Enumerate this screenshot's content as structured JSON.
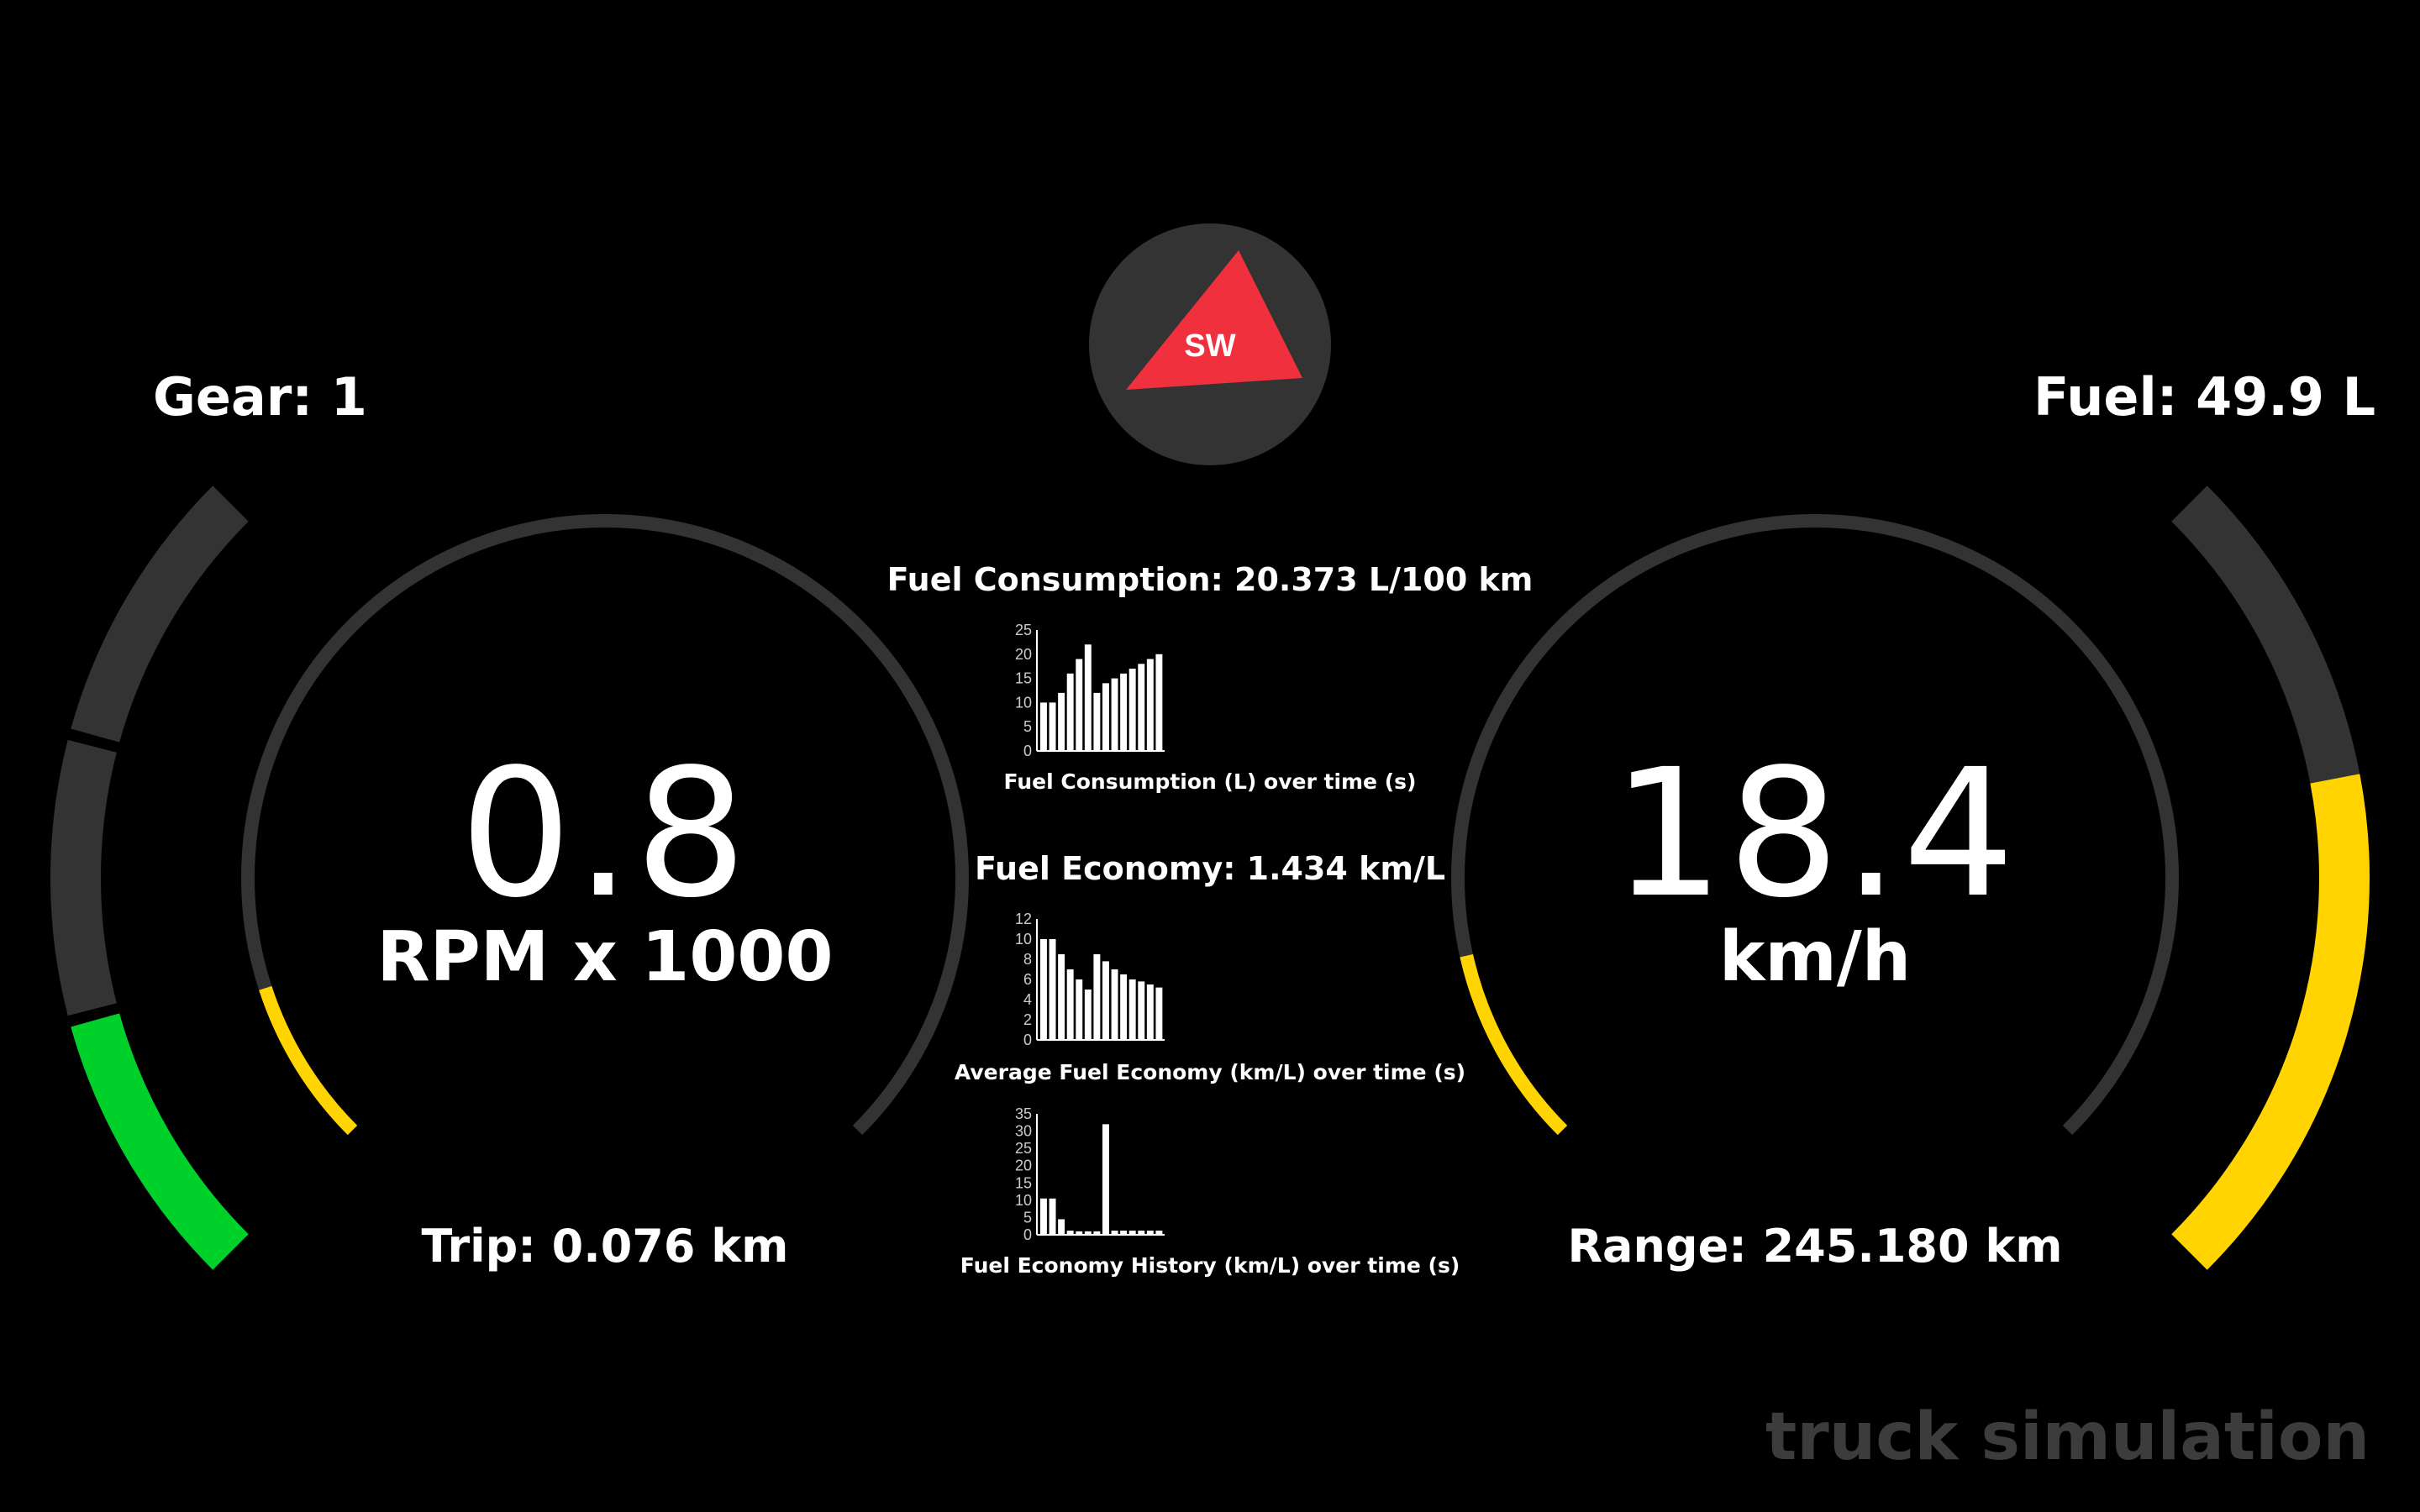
{
  "header": {
    "gear_label": "Gear: 1",
    "fuel_label": "Fuel: 49.9 L",
    "compass_direction": "SW",
    "compass_icon": "compass-needle-icon"
  },
  "rpm_gauge": {
    "value": "0.8",
    "unit": "RPM x 1000",
    "fill_fraction": 0.1
  },
  "speed_gauge": {
    "value": "18.4",
    "unit": "km/h",
    "fill_fraction": 0.12
  },
  "left_bar": {
    "segments_lit": 1,
    "segments_total": 3,
    "color": "#00d12a"
  },
  "right_bar": {
    "fill_fraction": 0.62,
    "color": "#ffd400"
  },
  "trip_label": "Trip: 0.076 km",
  "range_label": "Range: 245.180 km",
  "center": {
    "consumption_title": "Fuel Consumption: 20.373 L/100 km",
    "economy_title": "Fuel Economy: 1.434 km/L",
    "watermark": "truck simulation"
  },
  "colors": {
    "background": "#000000",
    "track": "#333333",
    "accent_yellow": "#ffd400",
    "accent_green": "#00d12a",
    "compass_red": "#f0303c",
    "compass_bg": "#333333"
  },
  "chart_data": [
    {
      "type": "bar",
      "title": "",
      "xlabel": "Fuel Consumption (L) over time (s)",
      "ylabel": "",
      "ylim": [
        0,
        25
      ],
      "yticks": [
        "0",
        "5",
        "10",
        "15",
        "20",
        "25"
      ],
      "values": [
        10,
        10,
        12,
        16,
        19,
        22,
        12,
        14,
        15,
        16,
        17,
        18,
        19,
        20
      ]
    },
    {
      "type": "bar",
      "title": "",
      "xlabel": "Average Fuel Economy (km/L) over time (s)",
      "ylabel": "",
      "ylim": [
        0,
        12
      ],
      "yticks": [
        "0",
        "2",
        "4",
        "6",
        "8",
        "10",
        "12"
      ],
      "values": [
        10,
        10,
        8.5,
        7,
        6,
        5,
        8.5,
        7.8,
        7,
        6.5,
        6,
        5.8,
        5.5,
        5.2
      ]
    },
    {
      "type": "bar",
      "title": "",
      "xlabel": "Fuel Economy History (km/L) over time (s)",
      "ylabel": "",
      "ylim": [
        0,
        35
      ],
      "yticks": [
        "0",
        "5",
        "10",
        "15",
        "20",
        "25",
        "30",
        "35"
      ],
      "values": [
        10.5,
        10.5,
        4.5,
        1.2,
        1,
        1,
        1,
        32,
        1.2,
        1.2,
        1.2,
        1.2,
        1.2,
        1.2
      ]
    }
  ]
}
